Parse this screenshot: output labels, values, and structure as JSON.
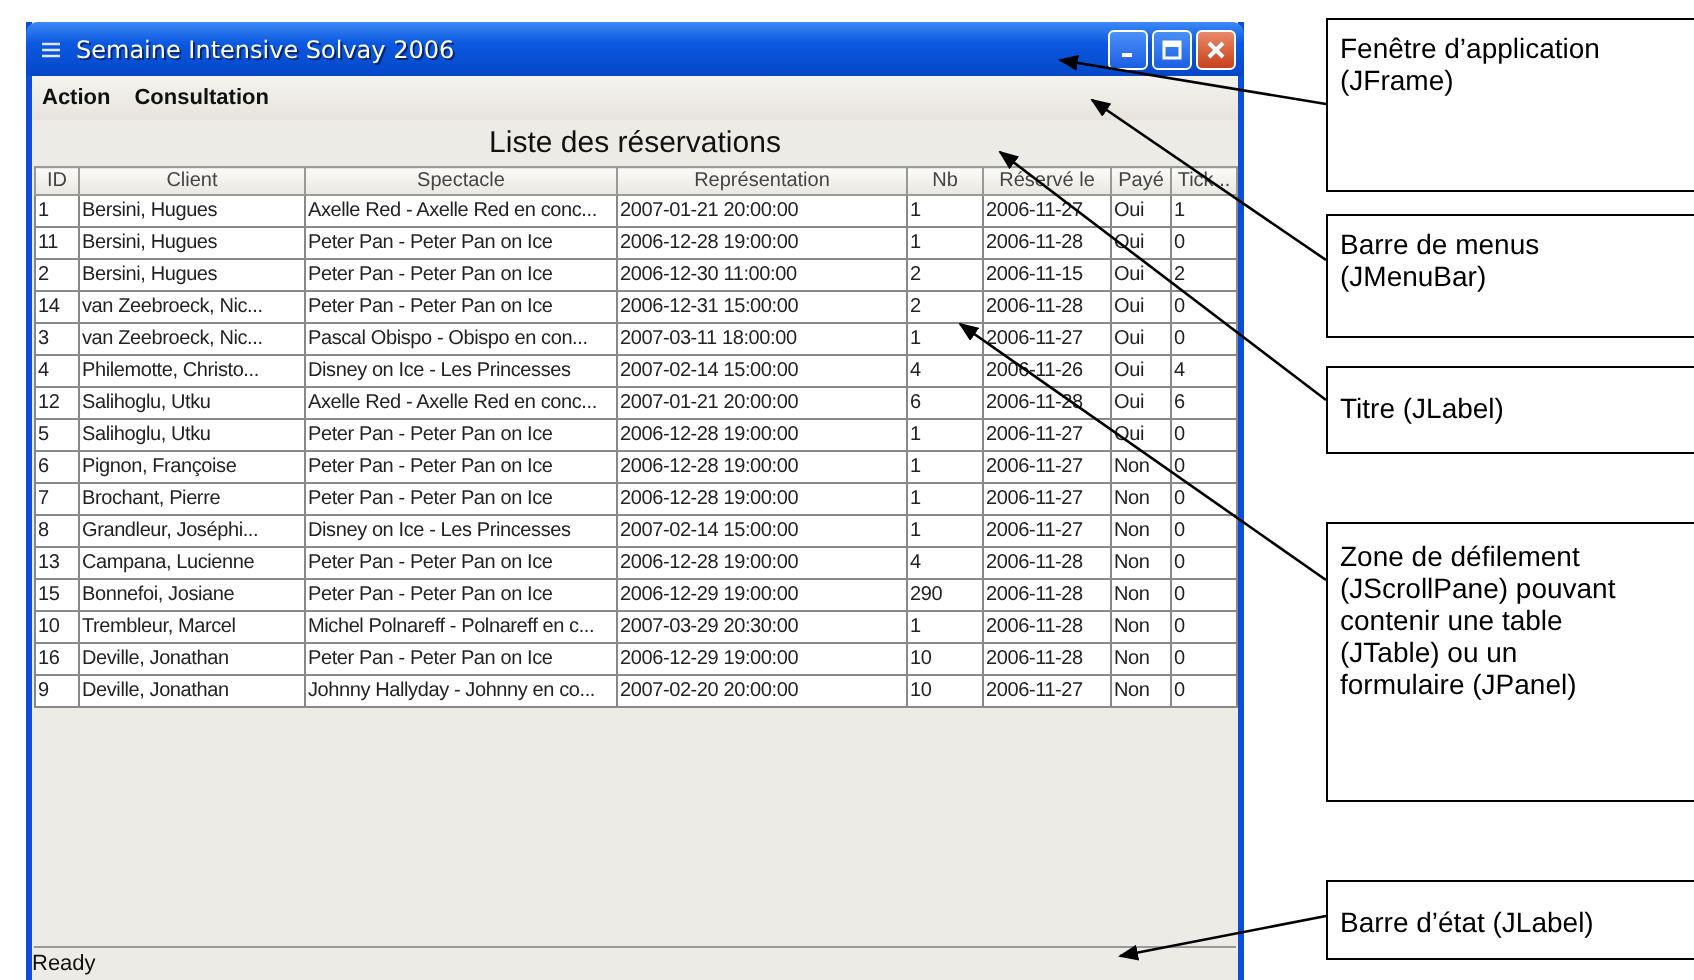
{
  "window": {
    "title": "Semaine Intensive Solvay 2006"
  },
  "menu_bar": [
    "Action",
    "Consultation"
  ],
  "heading": "Liste des réservations",
  "table": {
    "columns": [
      "ID",
      "Client",
      "Spectacle",
      "Représentation",
      "Nb",
      "Réservé le",
      "Payé",
      "Tick..."
    ],
    "rows": [
      [
        "1",
        "Bersini, Hugues",
        "Axelle Red - Axelle Red en conc...",
        "2007-01-21 20:00:00",
        "1",
        "2006-11-27",
        "Oui",
        "1"
      ],
      [
        "11",
        "Bersini, Hugues",
        "Peter Pan - Peter Pan on Ice",
        "2006-12-28 19:00:00",
        "1",
        "2006-11-28",
        "Oui",
        "0"
      ],
      [
        "2",
        "Bersini, Hugues",
        "Peter Pan - Peter Pan on Ice",
        "2006-12-30 11:00:00",
        "2",
        "2006-11-15",
        "Oui",
        "2"
      ],
      [
        "14",
        "van Zeebroeck, Nic...",
        "Peter Pan - Peter Pan on Ice",
        "2006-12-31 15:00:00",
        "2",
        "2006-11-28",
        "Oui",
        "0"
      ],
      [
        "3",
        "van Zeebroeck, Nic...",
        "Pascal Obispo - Obispo en con...",
        "2007-03-11 18:00:00",
        "1",
        "2006-11-27",
        "Oui",
        "0"
      ],
      [
        "4",
        "Philemotte, Christo...",
        "Disney on Ice - Les Princesses",
        "2007-02-14 15:00:00",
        "4",
        "2006-11-26",
        "Oui",
        "4"
      ],
      [
        "12",
        "Salihoglu, Utku",
        "Axelle Red - Axelle Red en conc...",
        "2007-01-21 20:00:00",
        "6",
        "2006-11-28",
        "Oui",
        "6"
      ],
      [
        "5",
        "Salihoglu, Utku",
        "Peter Pan - Peter Pan on Ice",
        "2006-12-28 19:00:00",
        "1",
        "2006-11-27",
        "Oui",
        "0"
      ],
      [
        "6",
        "Pignon, Françoise",
        "Peter Pan - Peter Pan on Ice",
        "2006-12-28 19:00:00",
        "1",
        "2006-11-27",
        "Non",
        "0"
      ],
      [
        "7",
        "Brochant, Pierre",
        "Peter Pan - Peter Pan on Ice",
        "2006-12-28 19:00:00",
        "1",
        "2006-11-27",
        "Non",
        "0"
      ],
      [
        "8",
        "Grandleur, Joséphi...",
        "Disney on Ice - Les Princesses",
        "2007-02-14 15:00:00",
        "1",
        "2006-11-27",
        "Non",
        "0"
      ],
      [
        "13",
        "Campana, Lucienne",
        "Peter Pan - Peter Pan on Ice",
        "2006-12-28 19:00:00",
        "4",
        "2006-11-28",
        "Non",
        "0"
      ],
      [
        "15",
        "Bonnefoi, Josiane",
        "Peter Pan - Peter Pan on Ice",
        "2006-12-29 19:00:00",
        "290",
        "2006-11-28",
        "Non",
        "0"
      ],
      [
        "10",
        "Trembleur, Marcel",
        "Michel Polnareff - Polnareff en c...",
        "2007-03-29 20:30:00",
        "1",
        "2006-11-28",
        "Non",
        "0"
      ],
      [
        "16",
        "Deville, Jonathan",
        "Peter Pan - Peter Pan on Ice",
        "2006-12-29 19:00:00",
        "10",
        "2006-11-28",
        "Non",
        "0"
      ],
      [
        "9",
        "Deville, Jonathan",
        "Johnny Hallyday - Johnny en co...",
        "2007-02-20 20:00:00",
        "10",
        "2006-11-27",
        "Non",
        "0"
      ]
    ]
  },
  "status_bar": "Ready",
  "annotations": [
    {
      "text": "Fenêtre d’application (JFrame)"
    },
    {
      "text": "Barre de menus (JMenuBar)"
    },
    {
      "text": "Titre (JLabel)"
    },
    {
      "text": "Zone de défilement (JScrollPane) pouvant contenir une table (JTable) ou un formulaire (JPanel)"
    },
    {
      "text": "Barre d’état (JLabel)"
    }
  ]
}
